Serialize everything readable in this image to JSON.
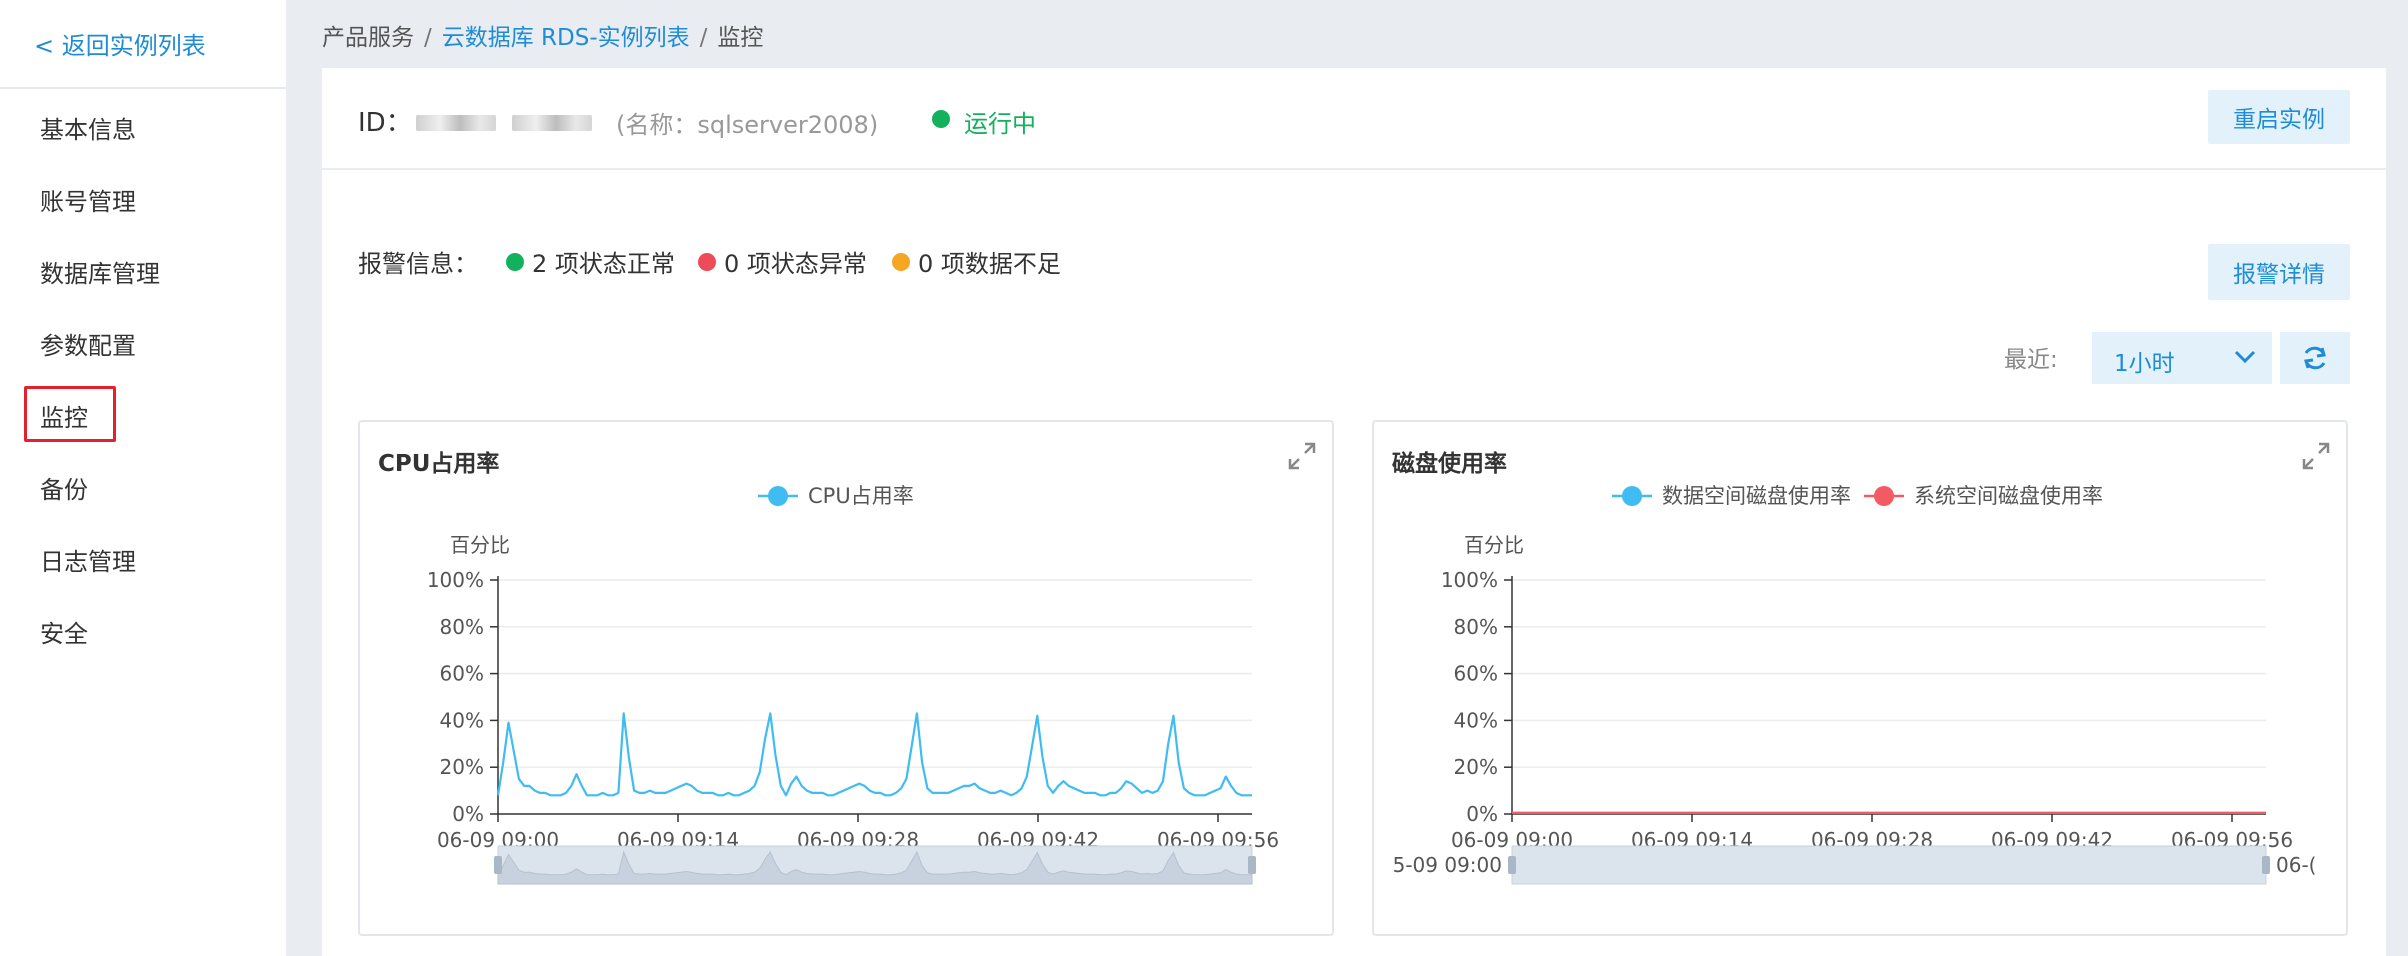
{
  "sidebar": {
    "back_label": "< 返回实例列表",
    "items": [
      {
        "label": "基本信息"
      },
      {
        "label": "账号管理"
      },
      {
        "label": "数据库管理"
      },
      {
        "label": "参数配置"
      },
      {
        "label": "监控",
        "active": true
      },
      {
        "label": "备份"
      },
      {
        "label": "日志管理"
      },
      {
        "label": "安全"
      }
    ]
  },
  "breadcrumb": {
    "items": [
      "产品服务",
      "云数据库 RDS-实例列表",
      "监控"
    ],
    "separator": "/"
  },
  "instance": {
    "id_label": "ID：",
    "name_text": "(名称：sqlserver2008)",
    "status": "运行中",
    "status_color": "#13b15b",
    "restart_label": "重启实例"
  },
  "alarm": {
    "label": "报警信息：",
    "normal": "2 项状态正常",
    "abnormal": "0 项状态异常",
    "insufficient": "0 项数据不足",
    "normal_color": "#13b15b",
    "abnormal_color": "#ee4a57",
    "insufficient_color": "#f5a623",
    "details_label": "报警详情"
  },
  "time_range": {
    "label": "最近:",
    "selected": "1小时"
  },
  "charts": {
    "cpu": {
      "title": "CPU占用率",
      "y_title": "百分比"
    },
    "disk": {
      "title": "磁盘使用率",
      "y_title": "百分比",
      "zoom_start_label": "5-09 09:00",
      "zoom_end_label": "06-("
    }
  },
  "chart_data": [
    {
      "type": "line",
      "title": "CPU占用率",
      "ylabel": "百分比",
      "yticks": [
        "0%",
        "20%",
        "40%",
        "60%",
        "80%",
        "100%"
      ],
      "ylim": [
        0,
        100
      ],
      "xticks": [
        "06-09 09:00",
        "06-09 09:14",
        "06-09 09:28",
        "06-09 09:42",
        "06-09 09:56"
      ],
      "legend": "top-center",
      "series": [
        {
          "name": "CPU占用率",
          "color": "#3fbcf2",
          "values": [
            8,
            22,
            39,
            27,
            15,
            12,
            12,
            10,
            9,
            9,
            8,
            8,
            8,
            9,
            12,
            17,
            12,
            8,
            8,
            8,
            9,
            8,
            8,
            9,
            43,
            24,
            10,
            9,
            9,
            10,
            9,
            9,
            9,
            10,
            11,
            12,
            13,
            12,
            10,
            9,
            9,
            9,
            8,
            8,
            9,
            8,
            8,
            9,
            10,
            12,
            18,
            32,
            43,
            25,
            12,
            8,
            13,
            16,
            12,
            10,
            9,
            9,
            9,
            8,
            8,
            9,
            10,
            11,
            12,
            13,
            12,
            10,
            9,
            9,
            8,
            8,
            9,
            11,
            15,
            29,
            43,
            22,
            11,
            9,
            9,
            9,
            9,
            10,
            11,
            12,
            12,
            13,
            11,
            10,
            9,
            9,
            10,
            9,
            8,
            9,
            11,
            16,
            29,
            42,
            24,
            12,
            9,
            12,
            14,
            12,
            11,
            10,
            9,
            9,
            9,
            8,
            8,
            9,
            9,
            11,
            14,
            13,
            11,
            9,
            10,
            9,
            10,
            14,
            30,
            42,
            22,
            11,
            9,
            8,
            8,
            8,
            9,
            10,
            11,
            16,
            12,
            9,
            8,
            8,
            8
          ]
        }
      ]
    },
    {
      "type": "line",
      "title": "磁盘使用率",
      "ylabel": "百分比",
      "yticks": [
        "0%",
        "20%",
        "40%",
        "60%",
        "80%",
        "100%"
      ],
      "ylim": [
        0,
        100
      ],
      "xticks": [
        "06-09 09:00",
        "06-09 09:14",
        "06-09 09:28",
        "06-09 09:42",
        "06-09 09:56"
      ],
      "legend": "top-center",
      "series": [
        {
          "name": "数据空间磁盘使用率",
          "color": "#3fbcf2",
          "values": [
            0.5,
            0.5,
            0.5,
            0.5,
            0.5,
            0.5,
            0.5,
            0.5,
            0.5
          ]
        },
        {
          "name": "系统空间磁盘使用率",
          "color": "#f35a63",
          "values": [
            0.5,
            0.5,
            0.5,
            0.5,
            0.5,
            0.5,
            0.5,
            0.5,
            0.5
          ]
        }
      ]
    }
  ]
}
